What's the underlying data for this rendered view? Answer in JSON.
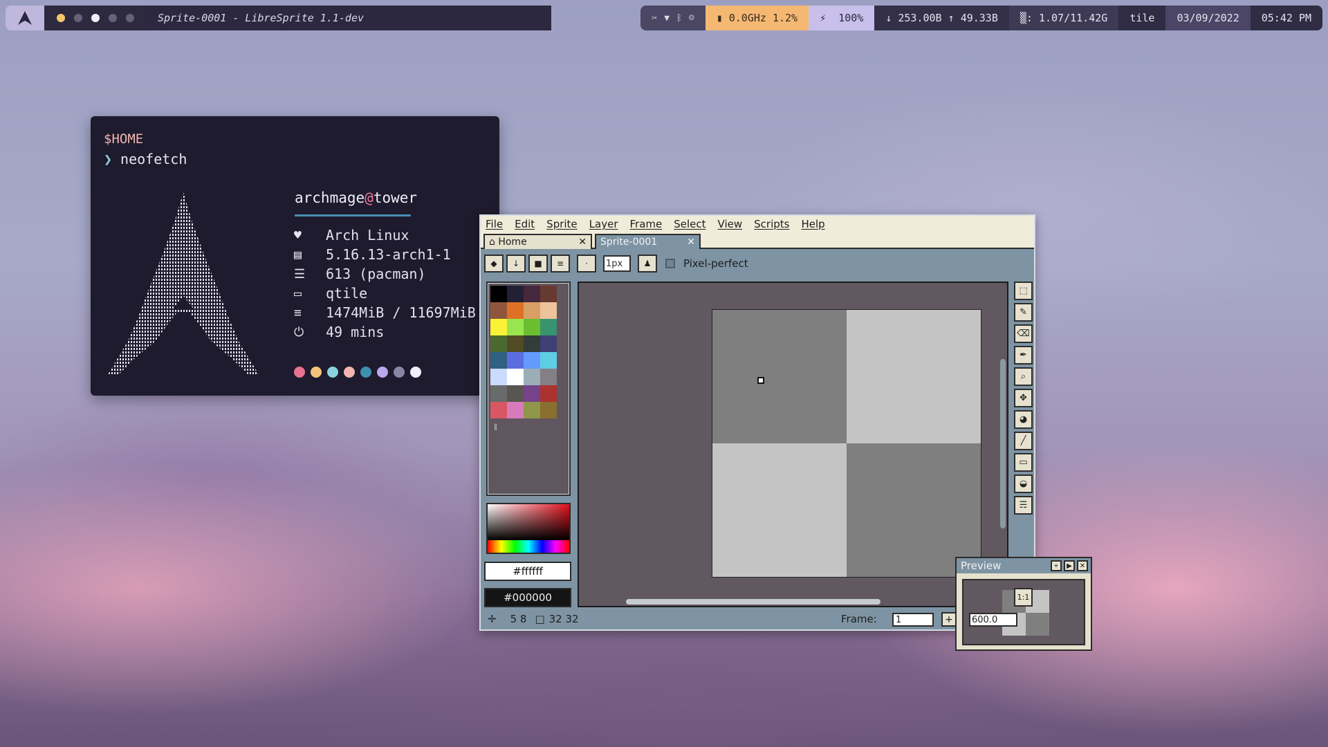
{
  "topbar": {
    "logo_icon": "arch-logo-icon",
    "workspaces": [
      "active",
      "inactive",
      "current",
      "inactive",
      "inactive"
    ],
    "window_title": "Sprite-0001 - LibreSprite 1.1-dev",
    "tray_icons": [
      "paperclip-icon",
      "wifi-icon",
      "bluetooth-icon",
      "discord-icon"
    ],
    "cpu": "0.0GHz 1.2%",
    "battery": "100%",
    "net_down": "253.00B",
    "net_up": "49.33B",
    "memory": "1.07/11.42G",
    "layout": "tile",
    "date": "03/09/2022",
    "time": "05:42 PM"
  },
  "terminal": {
    "cwd": "$HOME",
    "command": "neofetch",
    "user": "archmage",
    "at": "@",
    "host": "tower",
    "info": [
      {
        "icon": "heart-icon",
        "value": "Arch Linux"
      },
      {
        "icon": "box-icon",
        "value": "5.16.13-arch1-1"
      },
      {
        "icon": "database-icon",
        "value": "613 (pacman)"
      },
      {
        "icon": "monitor-icon",
        "value": "qtile"
      },
      {
        "icon": "memory-icon",
        "value": "1474MiB / 11697MiB"
      },
      {
        "icon": "power-icon",
        "value": "49 mins"
      }
    ],
    "colors": [
      "#e8728f",
      "#f4c47a",
      "#8ad1de",
      "#f2b5b0",
      "#3f8fae",
      "#b9a8ec",
      "#8a84a6",
      "#f0eef8"
    ]
  },
  "libresprite": {
    "menu": [
      "File",
      "Edit",
      "Sprite",
      "Layer",
      "Frame",
      "Select",
      "View",
      "Scripts",
      "Help"
    ],
    "tabs": {
      "home": "Home",
      "sprite": "Sprite-0001"
    },
    "toolbar": {
      "brush_size": "1px",
      "pixel_perfect": "Pixel-perfect"
    },
    "palette": [
      "#000000",
      "#222034",
      "#45283c",
      "#663931",
      "#8f563b",
      "#df7126",
      "#d9a066",
      "#eec39a",
      "#fbf236",
      "#99e550",
      "#6abe30",
      "#37946e",
      "#4b692f",
      "#524b24",
      "#323c39",
      "#3f3f74",
      "#306082",
      "#5b6ee1",
      "#639bff",
      "#5fcde4",
      "#cbdbfc",
      "#ffffff",
      "#9badb7",
      "#847e87",
      "#696a6a",
      "#595652",
      "#76428a",
      "#ac3232",
      "#d95763",
      "#d77bba",
      "#8f974a",
      "#8a6f30"
    ],
    "fg_color": "#ffffff",
    "bg_color": "#000000",
    "preview_title": "Preview",
    "status": {
      "pos": "5 8",
      "size": "32 32",
      "frame_label": "Frame:",
      "frame": "1",
      "zoom": "600.0"
    }
  }
}
